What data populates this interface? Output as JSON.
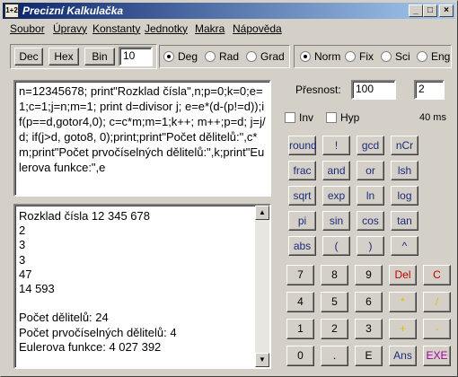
{
  "window": {
    "title": "Precizní Kalkulačka",
    "icon_text": "1+2",
    "controls": [
      "_",
      "□",
      "×"
    ]
  },
  "menu": [
    "Soubor",
    "Úpravy",
    "Konstanty",
    "Jednotky",
    "Makra",
    "Nápověda"
  ],
  "base": {
    "buttons": [
      "Dec",
      "Hex",
      "Bin"
    ],
    "value": "10"
  },
  "angle": {
    "options": [
      "Deg",
      "Rad",
      "Grad"
    ],
    "selected": "Deg"
  },
  "format": {
    "options": [
      "Norm",
      "Fix",
      "Sci",
      "Eng"
    ],
    "selected": "Norm"
  },
  "precision": {
    "label": "Přesnost:",
    "value": "100",
    "value2": "2"
  },
  "options": {
    "inv_label": "Inv",
    "hyp_label": "Hyp",
    "time": "40 ms"
  },
  "editor": {
    "text": "n=12345678; print\"Rozklad čísla\",n;p=0;k=0;e=1;c=1;j=n;m=1; print d=divisor j; e=e*(d-(p!=d));if(p==d,gotor4,0); c=c*m;m=1;k++; m++;p=d; j=j/d; if(j>d, goto8, 0);print;print\"Počet dělitelů:\",c*m;print\"Počet prvočíselných dělitelů:\",k;print\"Eulerova funkce:\",e"
  },
  "output": {
    "lines": [
      "Rozklad čísla 12 345 678",
      "2",
      "3",
      "3",
      "47",
      "14 593",
      "",
      "Počet dělitelů: 24",
      "Počet prvočíselných dělitelů: 4",
      "Eulerova funkce: 4 027 392"
    ]
  },
  "function_keys": [
    [
      "round",
      "!",
      "gcd",
      "nCr"
    ],
    [
      "frac",
      "and",
      "or",
      "lsh"
    ],
    [
      "sqrt",
      "exp",
      "ln",
      "log"
    ],
    [
      "pi",
      "sin",
      "cos",
      "tan"
    ],
    [
      "abs",
      "(",
      ")",
      "^"
    ]
  ],
  "keypad": [
    [
      {
        "label": "7",
        "color": "#000000"
      },
      {
        "label": "8",
        "color": "#000000"
      },
      {
        "label": "9",
        "color": "#000000"
      },
      {
        "label": "Del",
        "color": "#c00000"
      },
      {
        "label": "C",
        "color": "#c00000"
      }
    ],
    [
      {
        "label": "4",
        "color": "#000000"
      },
      {
        "label": "5",
        "color": "#000000"
      },
      {
        "label": "6",
        "color": "#000000"
      },
      {
        "label": "*",
        "color": "#e0c000"
      },
      {
        "label": "/",
        "color": "#e0c000"
      }
    ],
    [
      {
        "label": "1",
        "color": "#000000"
      },
      {
        "label": "2",
        "color": "#000000"
      },
      {
        "label": "3",
        "color": "#000000"
      },
      {
        "label": "+",
        "color": "#e0c000"
      },
      {
        "label": "-",
        "color": "#e0c000"
      }
    ],
    [
      {
        "label": "0",
        "color": "#000000"
      },
      {
        "label": ".",
        "color": "#000000"
      },
      {
        "label": "E",
        "color": "#000000"
      },
      {
        "label": "Ans",
        "color": "#1c2a7a"
      },
      {
        "label": "EXE",
        "color": "#a000a0"
      }
    ]
  ],
  "colors": {
    "title_start": "#0a246a",
    "title_end": "#a6caf0",
    "function_key_text": "#1c2a7a"
  }
}
